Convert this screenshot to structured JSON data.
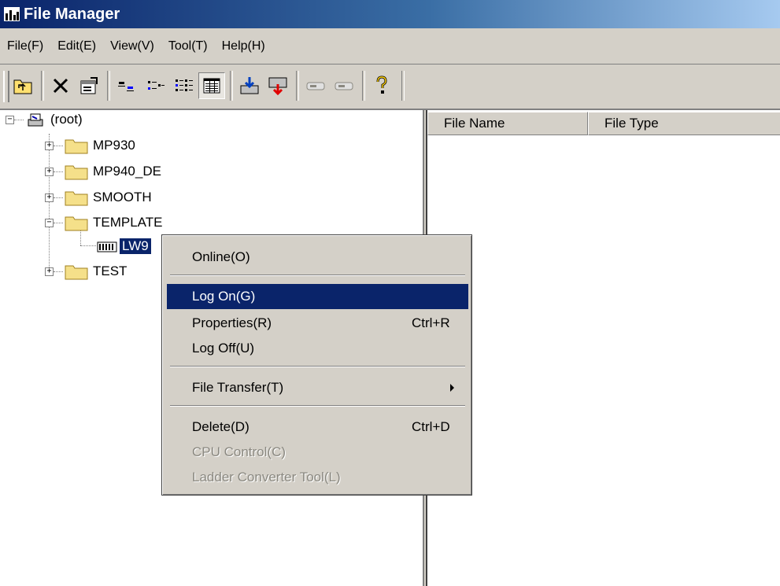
{
  "window": {
    "title": "File Manager"
  },
  "menubar": [
    "File(F)",
    "Edit(E)",
    "View(V)",
    "Tool(T)",
    "Help(H)"
  ],
  "toolbar": {
    "buttons": [
      "up-folder-icon",
      "delete-icon",
      "properties-icon",
      "large-icons-icon",
      "small-icons-icon",
      "list-view-icon",
      "details-view-icon",
      "download-icon",
      "upload-icon",
      "connect-icon",
      "disconnect-icon",
      "help-icon"
    ]
  },
  "tree": {
    "root": "(root)",
    "items": [
      "MP930",
      "MP940_DE",
      "SMOOTH",
      "TEMPLATE",
      "TEST"
    ],
    "child_of_template": "LW9"
  },
  "list": {
    "columns": [
      "File Name",
      "File Type"
    ]
  },
  "context_menu": {
    "items": [
      {
        "label": "Online(O)",
        "accel": ""
      },
      {
        "label": "Log On(G)",
        "accel": ""
      },
      {
        "label": "Properties(R)",
        "accel": "Ctrl+R"
      },
      {
        "label": "Log Off(U)",
        "accel": ""
      },
      {
        "label": "File Transfer(T)",
        "accel": ""
      },
      {
        "label": "Delete(D)",
        "accel": "Ctrl+D"
      },
      {
        "label": "CPU Control(C)",
        "accel": ""
      },
      {
        "label": "Ladder Converter Tool(L)",
        "accel": ""
      }
    ]
  },
  "colors": {
    "highlight": "#0a246a",
    "face": "#d4d0c8",
    "title_start": "#0a246a",
    "title_end": "#a6caf0"
  }
}
